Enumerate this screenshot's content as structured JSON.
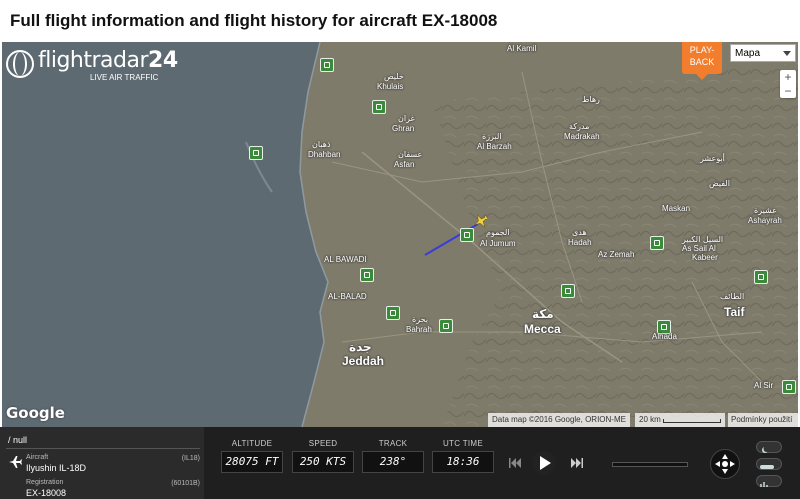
{
  "page": {
    "title": "Full flight information and flight history for aircraft EX-18008"
  },
  "map": {
    "logo": {
      "name_prefix": "flightradar",
      "name_suffix": "24",
      "tagline": "LIVE AIR TRAFFIC"
    },
    "playback_label_1": "PLAY-",
    "playback_label_2": "BACK",
    "map_type": "Mapa",
    "zoom_in": "+",
    "zoom_out": "−",
    "google": "Google",
    "attribution": "Data map ©2016 Google, ORION-ME",
    "scale": "20 km",
    "terms": "Podmínky použití",
    "labels": {
      "al_kamil": "Al Kamil",
      "khulais": "Khulais",
      "khulais_ar": "خليص",
      "ghran": "Ghran",
      "ghran_ar": "غران",
      "madrakah": "Madrakah",
      "madrakah_ar": "مدركة",
      "rahat_ar": "رهاط",
      "al_barzah": "Al Barzah",
      "al_barzah_ar": "البرزة",
      "dhahban": "Dhahban",
      "dhahban_ar": "ذهبان",
      "asfan": "Asfan",
      "asfan_ar": "عسفان",
      "ushaira_ar": "أبوعشر",
      "al_fayd_ar": "الفيض",
      "maskan": "Maskan",
      "ashayrah": "Ashayrah",
      "ashayrah_ar": "عشيرة",
      "al_jumum": "Al Jumum",
      "al_jumum_ar": "الجموم",
      "hadah": "Hadah",
      "hadah_ar": "هدى",
      "az_zemah": "Az Zemah",
      "as_sail": "As Sail Al",
      "kabeer": "Kabeer",
      "as_sail_ar": "السيل الكبير",
      "al_bawadi": "AL BAWADI",
      "al_balad": "AL-BALAD",
      "bahrah": "Bahrah",
      "bahrah_ar": "بحرة",
      "mecca": "Mecca",
      "mecca_ar": "مكة",
      "jeddah": "Jeddah",
      "jeddah_ar": "جدة",
      "taif": "Taif",
      "taif_ar": "الطائف",
      "alhada": "Alhada",
      "al_sir": "Al Sir"
    }
  },
  "panel": {
    "flight": "/ null",
    "aircraft_label": "Aircraft",
    "aircraft_value": "Ilyushin IL-18D",
    "aircraft_code": "(IL18)",
    "registration_label": "Registration",
    "registration_value": "EX-18008",
    "registration_code": "(60101B)",
    "altitude_label": "ALTITUDE",
    "altitude_value": "28075 FT",
    "speed_label": "SPEED",
    "speed_value": "250 KTS",
    "track_label": "TRACK",
    "track_value": "238°",
    "utc_label": "UTC TIME",
    "utc_value": "18:36"
  },
  "colors": {
    "map_land": "#7f7b6b",
    "map_sea": "#5e6a72",
    "flight_path": "#3b3bd9",
    "aircraft": "#f0d040",
    "playback": "#f27d2d",
    "airport": "#3b8a3b"
  }
}
